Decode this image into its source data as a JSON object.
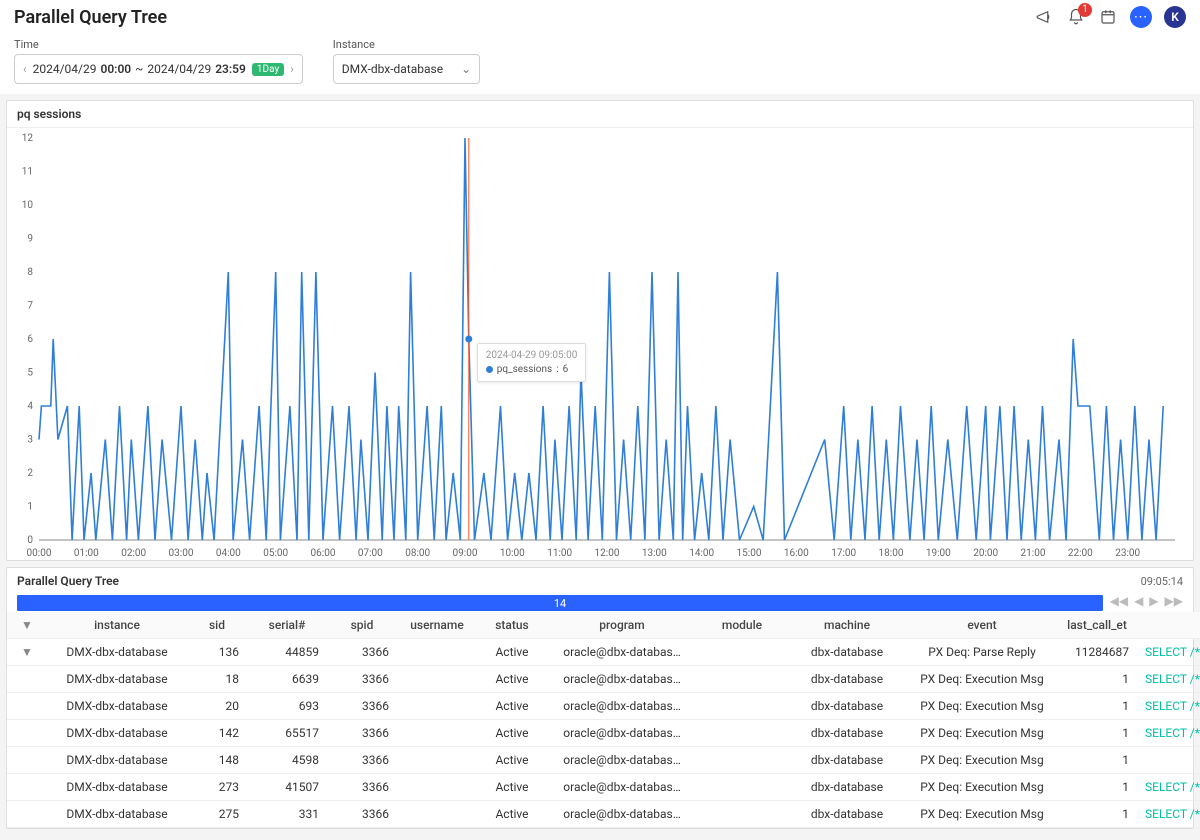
{
  "header": {
    "title": "Parallel Query Tree",
    "notification_count": "1",
    "avatar_letter": "K"
  },
  "controls": {
    "time_label": "Time",
    "instance_label": "Instance",
    "time_from_date": "2024/04/29",
    "time_from_time": "00:00",
    "time_sep": "~",
    "time_to_date": "2024/04/29",
    "time_to_time": "23:59",
    "range_tag": "1Day",
    "instance_value": "DMX-dbx-database"
  },
  "chart_panel": {
    "title": "pq sessions",
    "tooltip_time": "2024-04-29 09:05:00",
    "tooltip_series": "pq_sessions",
    "tooltip_value": "6"
  },
  "chart_data": {
    "type": "line",
    "title": "pq sessions",
    "xlabel": "",
    "ylabel": "",
    "ylim": [
      0,
      12
    ],
    "xlim_hours": [
      0,
      24
    ],
    "x_ticks": [
      "00:00",
      "01:00",
      "02:00",
      "03:00",
      "04:00",
      "05:00",
      "06:00",
      "07:00",
      "08:00",
      "09:00",
      "10:00",
      "11:00",
      "12:00",
      "13:00",
      "14:00",
      "15:00",
      "16:00",
      "17:00",
      "18:00",
      "19:00",
      "20:00",
      "21:00",
      "22:00",
      "23:00"
    ],
    "y_ticks": [
      0,
      1,
      2,
      3,
      4,
      5,
      6,
      7,
      8,
      9,
      10,
      11,
      12
    ],
    "cursor_x": 9.08,
    "cursor_y": 6,
    "series": [
      {
        "name": "pq_sessions",
        "color": "#2f7ed8",
        "points": [
          [
            0.0,
            3
          ],
          [
            0.05,
            4
          ],
          [
            0.25,
            4
          ],
          [
            0.3,
            6
          ],
          [
            0.4,
            3
          ],
          [
            0.6,
            4
          ],
          [
            0.7,
            0
          ],
          [
            0.85,
            4
          ],
          [
            0.95,
            0
          ],
          [
            1.1,
            2
          ],
          [
            1.2,
            0
          ],
          [
            1.4,
            3
          ],
          [
            1.55,
            0
          ],
          [
            1.7,
            4
          ],
          [
            1.85,
            0
          ],
          [
            1.95,
            3
          ],
          [
            2.1,
            0
          ],
          [
            2.3,
            4
          ],
          [
            2.45,
            0
          ],
          [
            2.6,
            3
          ],
          [
            2.8,
            0
          ],
          [
            3.0,
            4
          ],
          [
            3.15,
            0
          ],
          [
            3.3,
            3
          ],
          [
            3.45,
            0
          ],
          [
            3.55,
            2
          ],
          [
            3.7,
            0
          ],
          [
            3.85,
            4
          ],
          [
            4.0,
            8
          ],
          [
            4.1,
            0
          ],
          [
            4.3,
            3
          ],
          [
            4.45,
            0
          ],
          [
            4.65,
            4
          ],
          [
            4.8,
            0
          ],
          [
            5.0,
            8
          ],
          [
            5.1,
            0
          ],
          [
            5.3,
            4
          ],
          [
            5.45,
            0
          ],
          [
            5.55,
            8
          ],
          [
            5.7,
            0
          ],
          [
            5.85,
            8
          ],
          [
            6.0,
            0
          ],
          [
            6.2,
            4
          ],
          [
            6.35,
            0
          ],
          [
            6.55,
            4
          ],
          [
            6.7,
            0
          ],
          [
            6.8,
            3
          ],
          [
            6.95,
            0
          ],
          [
            7.1,
            5
          ],
          [
            7.25,
            0
          ],
          [
            7.35,
            4
          ],
          [
            7.5,
            0
          ],
          [
            7.6,
            4
          ],
          [
            7.75,
            0
          ],
          [
            7.85,
            8
          ],
          [
            8.0,
            0
          ],
          [
            8.2,
            4
          ],
          [
            8.35,
            0
          ],
          [
            8.5,
            4
          ],
          [
            8.6,
            0
          ],
          [
            8.75,
            2
          ],
          [
            8.9,
            0
          ],
          [
            9.0,
            12
          ],
          [
            9.08,
            6
          ],
          [
            9.2,
            0
          ],
          [
            9.4,
            2
          ],
          [
            9.55,
            0
          ],
          [
            9.75,
            4
          ],
          [
            9.9,
            0
          ],
          [
            10.05,
            2
          ],
          [
            10.2,
            0
          ],
          [
            10.35,
            2
          ],
          [
            10.5,
            0
          ],
          [
            10.65,
            4
          ],
          [
            10.8,
            0
          ],
          [
            10.9,
            3
          ],
          [
            11.05,
            0
          ],
          [
            11.2,
            4
          ],
          [
            11.35,
            0
          ],
          [
            11.45,
            5
          ],
          [
            11.6,
            0
          ],
          [
            11.75,
            4
          ],
          [
            11.9,
            0
          ],
          [
            12.05,
            8
          ],
          [
            12.2,
            0
          ],
          [
            12.35,
            3
          ],
          [
            12.5,
            0
          ],
          [
            12.65,
            4
          ],
          [
            12.8,
            0
          ],
          [
            12.95,
            8
          ],
          [
            13.1,
            0
          ],
          [
            13.25,
            3
          ],
          [
            13.4,
            0
          ],
          [
            13.5,
            8
          ],
          [
            13.6,
            0
          ],
          [
            13.7,
            4
          ],
          [
            13.85,
            0
          ],
          [
            14.0,
            2
          ],
          [
            14.15,
            0
          ],
          [
            14.3,
            4
          ],
          [
            14.45,
            0
          ],
          [
            14.6,
            3
          ],
          [
            14.8,
            0
          ],
          [
            15.1,
            1
          ],
          [
            15.3,
            0
          ],
          [
            15.6,
            8
          ],
          [
            15.75,
            0
          ],
          [
            16.6,
            3
          ],
          [
            16.8,
            0
          ],
          [
            17.0,
            4
          ],
          [
            17.15,
            0
          ],
          [
            17.3,
            3
          ],
          [
            17.45,
            0
          ],
          [
            17.6,
            4
          ],
          [
            17.75,
            0
          ],
          [
            17.9,
            3
          ],
          [
            18.05,
            0
          ],
          [
            18.2,
            4
          ],
          [
            18.4,
            0
          ],
          [
            18.55,
            3
          ],
          [
            18.7,
            0
          ],
          [
            18.85,
            4
          ],
          [
            19.0,
            0
          ],
          [
            19.2,
            3
          ],
          [
            19.4,
            0
          ],
          [
            19.6,
            4
          ],
          [
            19.8,
            0
          ],
          [
            20.0,
            4
          ],
          [
            20.1,
            0
          ],
          [
            20.3,
            4
          ],
          [
            20.45,
            0
          ],
          [
            20.6,
            4
          ],
          [
            20.75,
            0
          ],
          [
            20.9,
            3
          ],
          [
            21.05,
            0
          ],
          [
            21.2,
            4
          ],
          [
            21.35,
            0
          ],
          [
            21.55,
            3
          ],
          [
            21.7,
            0
          ],
          [
            21.85,
            6
          ],
          [
            21.95,
            4
          ],
          [
            22.05,
            4
          ],
          [
            22.2,
            4
          ],
          [
            22.4,
            0
          ],
          [
            22.55,
            4
          ],
          [
            22.7,
            0
          ],
          [
            22.85,
            3
          ],
          [
            23.0,
            0
          ],
          [
            23.15,
            4
          ],
          [
            23.3,
            0
          ],
          [
            23.45,
            3
          ],
          [
            23.6,
            0
          ],
          [
            23.75,
            4
          ]
        ]
      }
    ]
  },
  "table_panel": {
    "title": "Parallel Query Tree",
    "timestamp": "09:05:14",
    "bar_value": "14",
    "columns": [
      "",
      "instance",
      "sid",
      "serial#",
      "spid",
      "username",
      "status",
      "program",
      "module",
      "machine",
      "event",
      "last_call_et",
      ""
    ],
    "sql_link_prefix": "SELECT /*jskqjc",
    "rows": [
      {
        "expand": true,
        "instance": "DMX-dbx-database",
        "sid": "136",
        "serial": "44859",
        "spid": "3366",
        "username": "",
        "status": "Active",
        "program": "oracle@dbx-databas…",
        "module": "",
        "machine": "dbx-database",
        "event": "PX Deq: Parse Reply",
        "last_call_et": "11284687",
        "sql": true
      },
      {
        "expand": false,
        "instance": "DMX-dbx-database",
        "sid": "18",
        "serial": "6639",
        "spid": "3366",
        "username": "",
        "status": "Active",
        "program": "oracle@dbx-databas…",
        "module": "",
        "machine": "dbx-database",
        "event": "PX Deq: Execution Msg",
        "last_call_et": "1",
        "sql": true
      },
      {
        "expand": false,
        "instance": "DMX-dbx-database",
        "sid": "20",
        "serial": "693",
        "spid": "3366",
        "username": "",
        "status": "Active",
        "program": "oracle@dbx-databas…",
        "module": "",
        "machine": "dbx-database",
        "event": "PX Deq: Execution Msg",
        "last_call_et": "1",
        "sql": true
      },
      {
        "expand": false,
        "instance": "DMX-dbx-database",
        "sid": "142",
        "serial": "65517",
        "spid": "3366",
        "username": "",
        "status": "Active",
        "program": "oracle@dbx-databas…",
        "module": "",
        "machine": "dbx-database",
        "event": "PX Deq: Execution Msg",
        "last_call_et": "1",
        "sql": true
      },
      {
        "expand": false,
        "instance": "DMX-dbx-database",
        "sid": "148",
        "serial": "4598",
        "spid": "3366",
        "username": "",
        "status": "Active",
        "program": "oracle@dbx-databas…",
        "module": "",
        "machine": "dbx-database",
        "event": "PX Deq: Execution Msg",
        "last_call_et": "1",
        "sql": false
      },
      {
        "expand": false,
        "instance": "DMX-dbx-database",
        "sid": "273",
        "serial": "41507",
        "spid": "3366",
        "username": "",
        "status": "Active",
        "program": "oracle@dbx-databas…",
        "module": "",
        "machine": "dbx-database",
        "event": "PX Deq: Execution Msg",
        "last_call_et": "1",
        "sql": true
      },
      {
        "expand": false,
        "instance": "DMX-dbx-database",
        "sid": "275",
        "serial": "331",
        "spid": "3366",
        "username": "",
        "status": "Active",
        "program": "oracle@dbx-databas…",
        "module": "",
        "machine": "dbx-database",
        "event": "PX Deq: Execution Msg",
        "last_call_et": "1",
        "sql": true
      }
    ]
  }
}
